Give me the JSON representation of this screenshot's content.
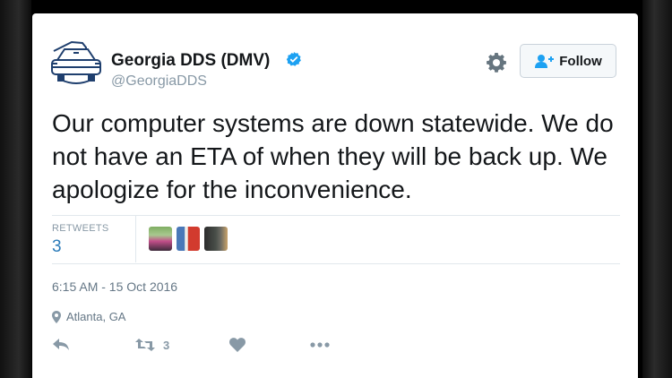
{
  "account": {
    "name": "Georgia DDS (DMV)",
    "handle": "@GeorgiaDDS"
  },
  "follow_button": {
    "label": "Follow"
  },
  "tweet": {
    "text": "Our computer systems are down statewide. We do not have an ETA of when they will be back up. We apologize for the inconvenience."
  },
  "stats": {
    "retweets_label": "RETWEETS",
    "retweets_count": "3"
  },
  "timestamp": "6:15 AM - 15 Oct 2016",
  "location": "Atlanta, GA",
  "actions": {
    "retweet_count": "3"
  },
  "colors": {
    "verified": "#1da1f2",
    "link": "#2b7bb9",
    "icon": "#8899a6",
    "follow_icon": "#1da1f2"
  },
  "icons": [
    "car-logo-icon",
    "verified-badge-icon",
    "gear-icon",
    "follow-person-icon",
    "location-pin-icon",
    "reply-icon",
    "retweet-icon",
    "like-heart-icon",
    "more-dots-icon"
  ]
}
